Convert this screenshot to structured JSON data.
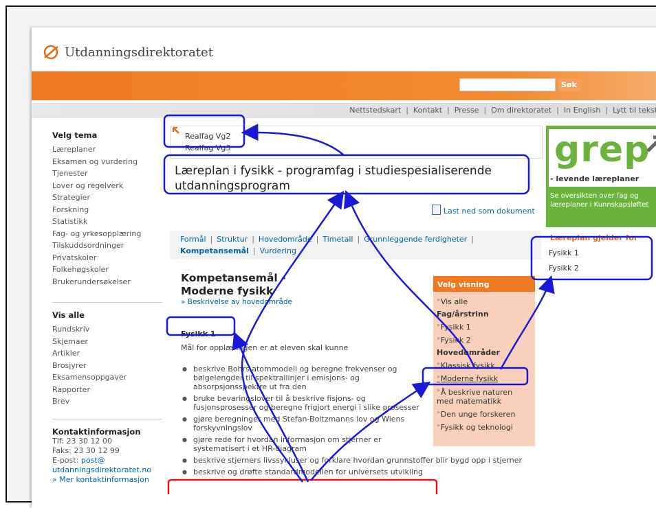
{
  "brand": {
    "name": "Utdanningsdirektoratet"
  },
  "search": {
    "value": "",
    "button_label": "Søk"
  },
  "topnav": [
    "Nettstedskart",
    "Kontakt",
    "Presse",
    "Om direktoratet",
    "In English",
    "Lytt til teksten"
  ],
  "sidebar": {
    "tema_title": "Velg tema",
    "tema_items": [
      "Læreplaner",
      "Eksamen og vurdering",
      "Tjenester",
      "Lover og regelverk",
      "Strategier",
      "Forskning",
      "Statistikk",
      "Fag- og yrkesopplæring",
      "Tilskuddsordninger",
      "Privatskoler",
      "Folkehøgskoler",
      "Brukerundersøkelser"
    ],
    "visalle_title": "Vis alle",
    "visalle_items": [
      "Rundskriv",
      "Skjemaer",
      "Artikler",
      "Brosjyrer",
      "Eksamensoppgaver",
      "Rapporter",
      "Brev"
    ],
    "contact": {
      "title": "Kontaktinformasjon",
      "phone": "Tlf: 23 30 12 00",
      "fax": "Faks: 23 30 12 99",
      "email_label": "E-post: ",
      "email_1": "post@",
      "email_2": "utdanningsdirektoratet.no",
      "more": "» Mer kontaktinformasjon"
    }
  },
  "breadcrumb": [
    "Realfag Vg2",
    "Realfag Vg3"
  ],
  "page_title": "Læreplan i fysikk - programfag i studiespesialiserende utdanningsprogram",
  "download_label": "Last ned som dokument",
  "tabs": {
    "row1": [
      "Formål",
      "Struktur",
      "Hovedområde",
      "Timetall",
      "Grunnleggende ferdigheter"
    ],
    "row2": [
      "Kompetansemål",
      "Vurdering"
    ],
    "active": "Kompetansemål"
  },
  "section": {
    "title_1": "Kompetansemål -",
    "title_2": "Moderne fysikk",
    "desc_link": "» Beskrivelse av hovedområde",
    "group": "Fysikk 1",
    "intro": "Mål for opplæringen er at eleven skal kunne",
    "goals": [
      "beskrive Bohrs atommodell og beregne frekvenser og bølgelengder til spektrallinjer i emisjons- og absorpsjonsspektre ut fra den",
      "bruke bevaringslover til å beskrive fisjons- og fusjonsprosesser og beregne frigjort energi i slike prosesser",
      "gjøre beregninger med Stefan-Boltzmanns lov og Wiens forskyvningslov",
      "gjøre rede for hvordan informasjon om stjerner er systematisert i et HR-diagram",
      "beskrive stjerners livssykluser og forklare hvordan grunnstoffer blir bygd opp i stjerner",
      "beskrive og drøfte standardmodellen for universets utvikling"
    ]
  },
  "velg_visning": {
    "title": "Velg visning",
    "vis_alle": "Vis alle",
    "fag_title": "Fag/årstrinn",
    "fag_items": [
      "Fysikk 1",
      "Fysikk 2"
    ],
    "hoved_title": "Hovedområder",
    "hoved_items": [
      "Klassisk fysikk",
      "Moderne fysikk",
      "Å beskrive naturen med matematikk",
      "Den unge forskeren",
      "Fysikk og teknologi"
    ],
    "selected": "Moderne fysikk"
  },
  "grep": {
    "word": "grep",
    "tagline": "- levende læreplaner",
    "text": "Se oversikten over fag og læreplaner i Kunnskapsløftet"
  },
  "laereplan": {
    "title": "Læreplan gjelder for",
    "items": [
      "Fysikk 1",
      "Fysikk 2"
    ]
  },
  "colors": {
    "accent": "#f07a22",
    "link": "#0064a8",
    "grep_green": "#6cb33e",
    "highlight_blue": "#1a1ad6",
    "highlight_red": "#e01818"
  }
}
